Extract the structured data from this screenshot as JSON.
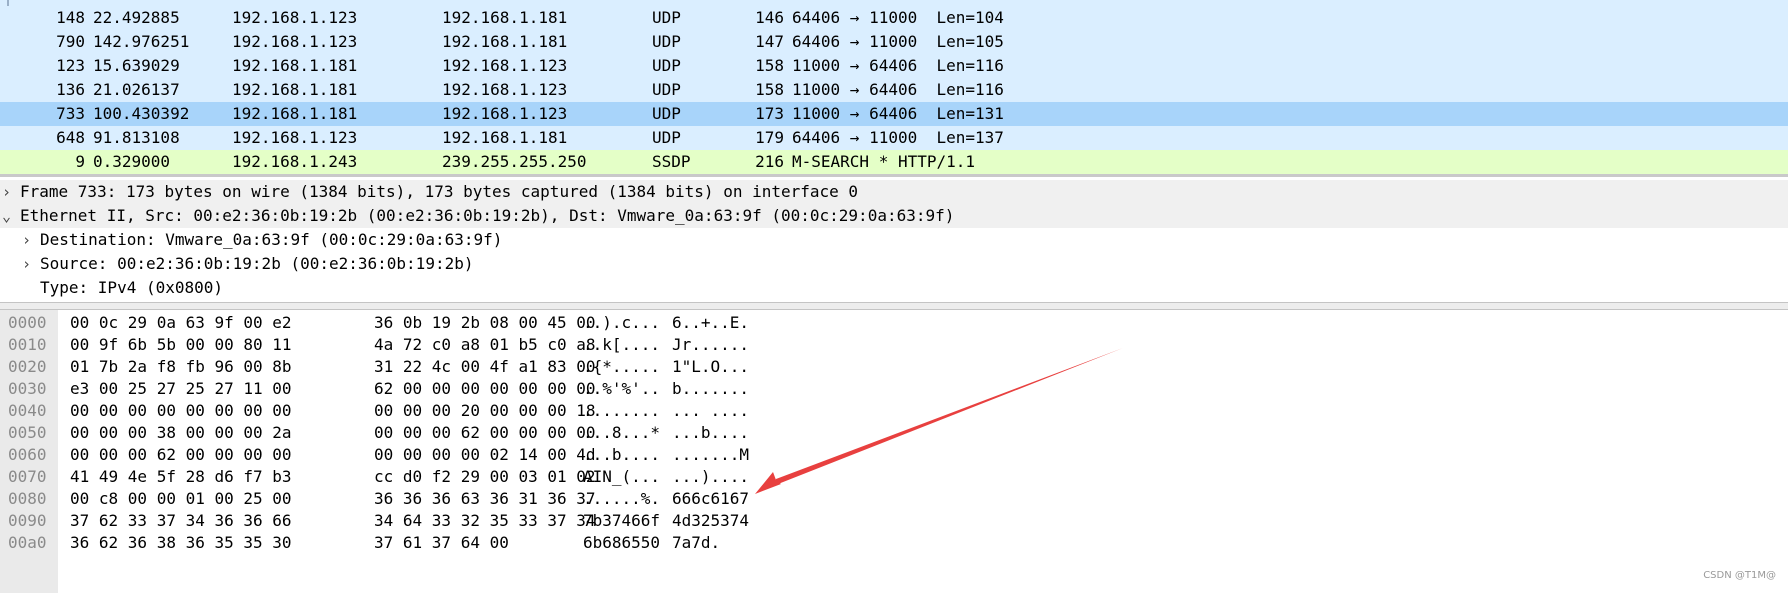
{
  "packet_list": {
    "rows": [
      {
        "no": "148",
        "time": "22.492885",
        "src": "192.168.1.123",
        "dst": "192.168.1.181",
        "proto": "UDP",
        "len": "146",
        "info": "64406 → 11000  Len=104",
        "style": "udp"
      },
      {
        "no": "790",
        "time": "142.976251",
        "src": "192.168.1.123",
        "dst": "192.168.1.181",
        "proto": "UDP",
        "len": "147",
        "info": "64406 → 11000  Len=105",
        "style": "udp"
      },
      {
        "no": "123",
        "time": "15.639029",
        "src": "192.168.1.181",
        "dst": "192.168.1.123",
        "proto": "UDP",
        "len": "158",
        "info": "11000 → 64406  Len=116",
        "style": "udp"
      },
      {
        "no": "136",
        "time": "21.026137",
        "src": "192.168.1.181",
        "dst": "192.168.1.123",
        "proto": "UDP",
        "len": "158",
        "info": "11000 → 64406  Len=116",
        "style": "udp"
      },
      {
        "no": "733",
        "time": "100.430392",
        "src": "192.168.1.181",
        "dst": "192.168.1.123",
        "proto": "UDP",
        "len": "173",
        "info": "11000 → 64406  Len=131",
        "style": "sel"
      },
      {
        "no": "648",
        "time": "91.813108",
        "src": "192.168.1.123",
        "dst": "192.168.1.181",
        "proto": "UDP",
        "len": "179",
        "info": "64406 → 11000  Len=137",
        "style": "udp"
      },
      {
        "no": "9",
        "time": "0.329000",
        "src": "192.168.1.243",
        "dst": "239.255.255.250",
        "proto": "SSDP",
        "len": "216",
        "info": "M-SEARCH * HTTP/1.1",
        "style": "ssdp"
      }
    ]
  },
  "details": {
    "rows": [
      {
        "arrow": "›",
        "indent": 0,
        "text": "Frame 733: 173 bytes on wire (1384 bits), 173 bytes captured (1384 bits) on interface 0"
      },
      {
        "arrow": "⌄",
        "indent": 0,
        "text": "Ethernet II, Src: 00:e2:36:0b:19:2b (00:e2:36:0b:19:2b), Dst: Vmware_0a:63:9f (00:0c:29:0a:63:9f)"
      },
      {
        "arrow": "›",
        "indent": 1,
        "text": "Destination: Vmware_0a:63:9f (00:0c:29:0a:63:9f)"
      },
      {
        "arrow": "›",
        "indent": 1,
        "text": "Source: 00:e2:36:0b:19:2b (00:e2:36:0b:19:2b)"
      },
      {
        "arrow": "",
        "indent": 1,
        "text": "Type: IPv4 (0x0800)"
      }
    ]
  },
  "bytes": {
    "rows": [
      {
        "offset": "0000",
        "hex1": "00 0c 29 0a 63 9f 00 e2",
        "hex2": "36 0b 19 2b 08 00 45 00",
        "ascii1": "..).c...",
        "ascii2": "6..+..E."
      },
      {
        "offset": "0010",
        "hex1": "00 9f 6b 5b 00 00 80 11",
        "hex2": "4a 72 c0 a8 01 b5 c0 a8",
        "ascii1": "..k[....",
        "ascii2": "Jr......"
      },
      {
        "offset": "0020",
        "hex1": "01 7b 2a f8 fb 96 00 8b",
        "hex2": "31 22 4c 00 4f a1 83 00",
        "ascii1": ".{*.....",
        "ascii2": "1\"L.O..."
      },
      {
        "offset": "0030",
        "hex1": "e3 00 25 27 25 27 11 00",
        "hex2": "62 00 00 00 00 00 00 00",
        "ascii1": "..%'%'..",
        "ascii2": "b......."
      },
      {
        "offset": "0040",
        "hex1": "00 00 00 00 00 00 00 00",
        "hex2": "00 00 00 20 00 00 00 18",
        "ascii1": "........",
        "ascii2": "... ...."
      },
      {
        "offset": "0050",
        "hex1": "00 00 00 38 00 00 00 2a",
        "hex2": "00 00 00 62 00 00 00 00",
        "ascii1": "...8...*",
        "ascii2": "...b...."
      },
      {
        "offset": "0060",
        "hex1": "00 00 00 62 00 00 00 00",
        "hex2": "00 00 00 00 02 14 00 4d",
        "ascii1": "...b....",
        "ascii2": ".......M"
      },
      {
        "offset": "0070",
        "hex1": "41 49 4e 5f 28 d6 f7 b3",
        "hex2": "cc d0 f2 29 00 03 01 02",
        "ascii1": "AIN_(...",
        "ascii2": "...)...."
      },
      {
        "offset": "0080",
        "hex1": "00 c8 00 00 01 00 25 00",
        "hex2": "36 36 36 63 36 31 36 37",
        "ascii1": "......%.",
        "ascii2": "666c6167"
      },
      {
        "offset": "0090",
        "hex1": "37 62 33 37 34 36 36 66",
        "hex2": "34 64 33 32 35 33 37 34",
        "ascii1": "7b37466f",
        "ascii2": "4d325374"
      },
      {
        "offset": "00a0",
        "hex1": "36 62 36 38 36 35 35 30",
        "hex2": "37 61 37 64 00",
        "ascii1": "6b686550",
        "ascii2": "7a7d."
      }
    ]
  },
  "annotation": {
    "color": "#e8403f"
  },
  "watermark": "CSDN @T1M@"
}
